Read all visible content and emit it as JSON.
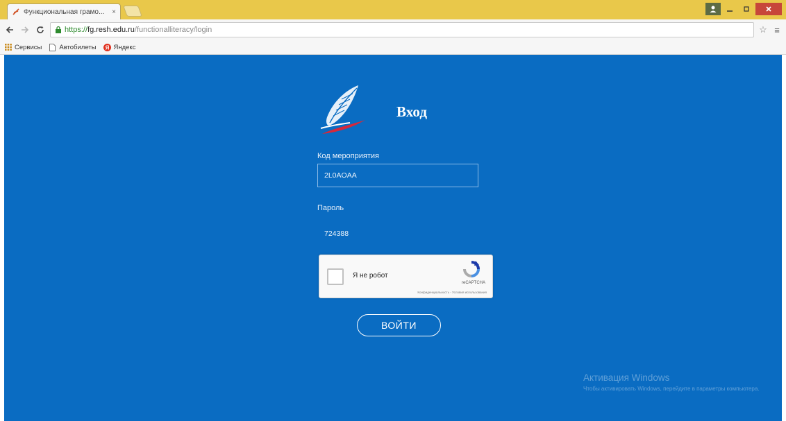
{
  "browser": {
    "tab_title": "Функциональная грамо...",
    "tab_close": "×",
    "url_scheme": "https://",
    "url_host": "fg.resh.edu.ru",
    "url_path": "/functionalliteracy/login",
    "bookmarks": [
      "Сервисы",
      "Автобилеты",
      "Яндекс"
    ]
  },
  "page": {
    "title": "Вход",
    "event_code_label": "Код мероприятия",
    "event_code_value": "2L0AOAA",
    "password_label": "Пароль",
    "password_value": "724388",
    "captcha_label": "Я не робот",
    "captcha_brand": "reCAPTCHA",
    "captcha_links": "Конфиденциальность - Условия использования",
    "login_button": "ВОЙТИ"
  },
  "windows_watermark": {
    "title": "Активация Windows",
    "text": "Чтобы активировать Windows, перейдите в параметры компьютера."
  },
  "colors": {
    "page_background": "#0a6cc2",
    "titlebar": "#e9c84a",
    "close_button": "#c7473a",
    "secure_url": "#2e8b2e"
  }
}
